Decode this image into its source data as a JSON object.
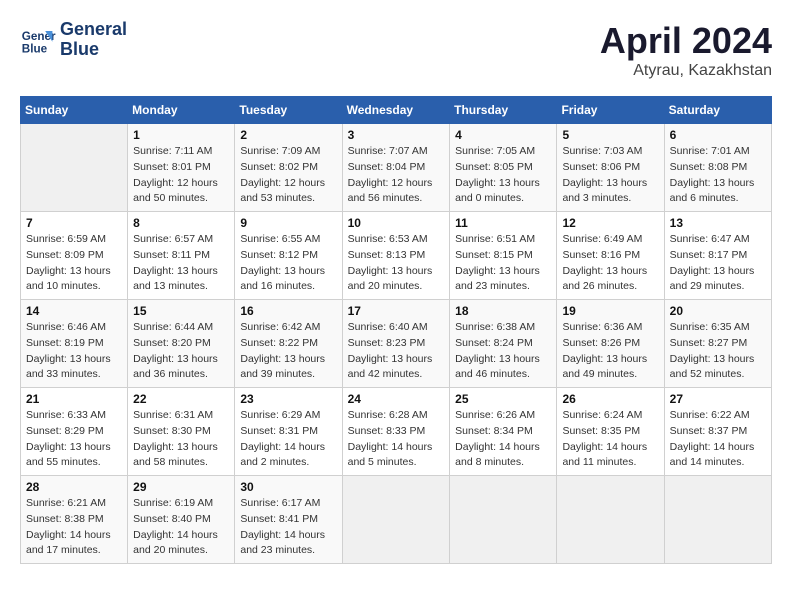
{
  "header": {
    "logo_line1": "General",
    "logo_line2": "Blue",
    "month": "April 2024",
    "location": "Atyrau, Kazakhstan"
  },
  "weekdays": [
    "Sunday",
    "Monday",
    "Tuesday",
    "Wednesday",
    "Thursday",
    "Friday",
    "Saturday"
  ],
  "weeks": [
    [
      {
        "day": "",
        "info": ""
      },
      {
        "day": "1",
        "info": "Sunrise: 7:11 AM\nSunset: 8:01 PM\nDaylight: 12 hours\nand 50 minutes."
      },
      {
        "day": "2",
        "info": "Sunrise: 7:09 AM\nSunset: 8:02 PM\nDaylight: 12 hours\nand 53 minutes."
      },
      {
        "day": "3",
        "info": "Sunrise: 7:07 AM\nSunset: 8:04 PM\nDaylight: 12 hours\nand 56 minutes."
      },
      {
        "day": "4",
        "info": "Sunrise: 7:05 AM\nSunset: 8:05 PM\nDaylight: 13 hours\nand 0 minutes."
      },
      {
        "day": "5",
        "info": "Sunrise: 7:03 AM\nSunset: 8:06 PM\nDaylight: 13 hours\nand 3 minutes."
      },
      {
        "day": "6",
        "info": "Sunrise: 7:01 AM\nSunset: 8:08 PM\nDaylight: 13 hours\nand 6 minutes."
      }
    ],
    [
      {
        "day": "7",
        "info": "Sunrise: 6:59 AM\nSunset: 8:09 PM\nDaylight: 13 hours\nand 10 minutes."
      },
      {
        "day": "8",
        "info": "Sunrise: 6:57 AM\nSunset: 8:11 PM\nDaylight: 13 hours\nand 13 minutes."
      },
      {
        "day": "9",
        "info": "Sunrise: 6:55 AM\nSunset: 8:12 PM\nDaylight: 13 hours\nand 16 minutes."
      },
      {
        "day": "10",
        "info": "Sunrise: 6:53 AM\nSunset: 8:13 PM\nDaylight: 13 hours\nand 20 minutes."
      },
      {
        "day": "11",
        "info": "Sunrise: 6:51 AM\nSunset: 8:15 PM\nDaylight: 13 hours\nand 23 minutes."
      },
      {
        "day": "12",
        "info": "Sunrise: 6:49 AM\nSunset: 8:16 PM\nDaylight: 13 hours\nand 26 minutes."
      },
      {
        "day": "13",
        "info": "Sunrise: 6:47 AM\nSunset: 8:17 PM\nDaylight: 13 hours\nand 29 minutes."
      }
    ],
    [
      {
        "day": "14",
        "info": "Sunrise: 6:46 AM\nSunset: 8:19 PM\nDaylight: 13 hours\nand 33 minutes."
      },
      {
        "day": "15",
        "info": "Sunrise: 6:44 AM\nSunset: 8:20 PM\nDaylight: 13 hours\nand 36 minutes."
      },
      {
        "day": "16",
        "info": "Sunrise: 6:42 AM\nSunset: 8:22 PM\nDaylight: 13 hours\nand 39 minutes."
      },
      {
        "day": "17",
        "info": "Sunrise: 6:40 AM\nSunset: 8:23 PM\nDaylight: 13 hours\nand 42 minutes."
      },
      {
        "day": "18",
        "info": "Sunrise: 6:38 AM\nSunset: 8:24 PM\nDaylight: 13 hours\nand 46 minutes."
      },
      {
        "day": "19",
        "info": "Sunrise: 6:36 AM\nSunset: 8:26 PM\nDaylight: 13 hours\nand 49 minutes."
      },
      {
        "day": "20",
        "info": "Sunrise: 6:35 AM\nSunset: 8:27 PM\nDaylight: 13 hours\nand 52 minutes."
      }
    ],
    [
      {
        "day": "21",
        "info": "Sunrise: 6:33 AM\nSunset: 8:29 PM\nDaylight: 13 hours\nand 55 minutes."
      },
      {
        "day": "22",
        "info": "Sunrise: 6:31 AM\nSunset: 8:30 PM\nDaylight: 13 hours\nand 58 minutes."
      },
      {
        "day": "23",
        "info": "Sunrise: 6:29 AM\nSunset: 8:31 PM\nDaylight: 14 hours\nand 2 minutes."
      },
      {
        "day": "24",
        "info": "Sunrise: 6:28 AM\nSunset: 8:33 PM\nDaylight: 14 hours\nand 5 minutes."
      },
      {
        "day": "25",
        "info": "Sunrise: 6:26 AM\nSunset: 8:34 PM\nDaylight: 14 hours\nand 8 minutes."
      },
      {
        "day": "26",
        "info": "Sunrise: 6:24 AM\nSunset: 8:35 PM\nDaylight: 14 hours\nand 11 minutes."
      },
      {
        "day": "27",
        "info": "Sunrise: 6:22 AM\nSunset: 8:37 PM\nDaylight: 14 hours\nand 14 minutes."
      }
    ],
    [
      {
        "day": "28",
        "info": "Sunrise: 6:21 AM\nSunset: 8:38 PM\nDaylight: 14 hours\nand 17 minutes."
      },
      {
        "day": "29",
        "info": "Sunrise: 6:19 AM\nSunset: 8:40 PM\nDaylight: 14 hours\nand 20 minutes."
      },
      {
        "day": "30",
        "info": "Sunrise: 6:17 AM\nSunset: 8:41 PM\nDaylight: 14 hours\nand 23 minutes."
      },
      {
        "day": "",
        "info": ""
      },
      {
        "day": "",
        "info": ""
      },
      {
        "day": "",
        "info": ""
      },
      {
        "day": "",
        "info": ""
      }
    ]
  ]
}
